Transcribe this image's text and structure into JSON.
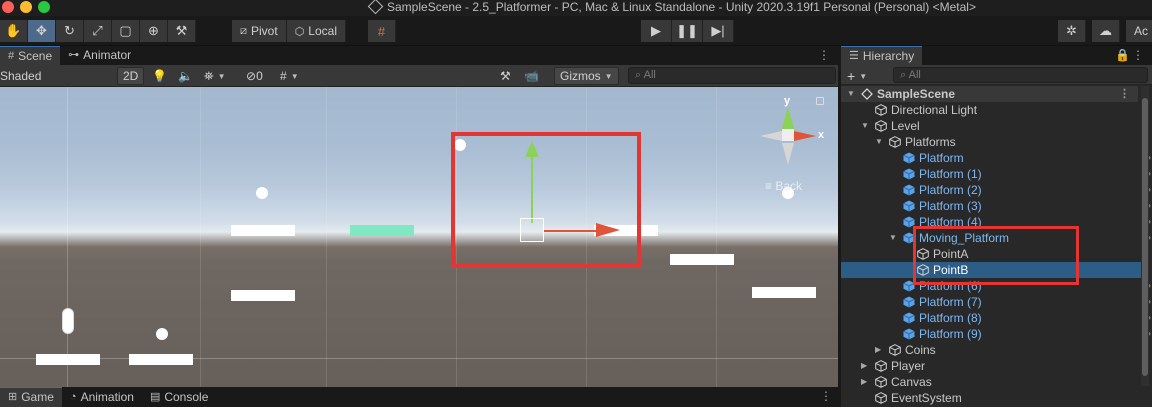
{
  "window": {
    "title": "SampleScene - 2.5_Platformer - PC, Mac & Linux Standalone - Unity 2020.3.19f1 Personal (Personal) <Metal>"
  },
  "toolbar": {
    "tools": [
      "hand-tool",
      "move-tool",
      "rotate-tool",
      "scale-tool",
      "rect-tool",
      "transform-tool",
      "custom-tool"
    ],
    "pivot_label": "Pivot",
    "local_label": "Local",
    "right_partial_label": "Ac"
  },
  "scene_tabs": {
    "scene": "Scene",
    "animator": "Animator"
  },
  "scene_toolbar": {
    "shading_mode": "Shaded",
    "mode_2d": "2D",
    "hidden_count": "0",
    "gizmos_label": "Gizmos",
    "search_placeholder": "All"
  },
  "orientation": {
    "y_label": "y",
    "x_label": "x",
    "back_label": "Back"
  },
  "bottom_tabs": {
    "game": "Game",
    "animation": "Animation",
    "console": "Console"
  },
  "hierarchy": {
    "tab_label": "Hierarchy",
    "add_label": "+",
    "search_placeholder": "All",
    "rows": [
      {
        "name": "SampleScene",
        "depth": 0,
        "kind": "scene",
        "expanded": true
      },
      {
        "name": "Directional Light",
        "depth": 1,
        "kind": "object"
      },
      {
        "name": "Level",
        "depth": 1,
        "kind": "object",
        "expanded": true
      },
      {
        "name": "Platforms",
        "depth": 2,
        "kind": "object",
        "expanded": true
      },
      {
        "name": "Platform",
        "depth": 3,
        "kind": "prefab"
      },
      {
        "name": "Platform (1)",
        "depth": 3,
        "kind": "prefab"
      },
      {
        "name": "Platform (2)",
        "depth": 3,
        "kind": "prefab"
      },
      {
        "name": "Platform (3)",
        "depth": 3,
        "kind": "prefab"
      },
      {
        "name": "Platform (4)",
        "depth": 3,
        "kind": "prefab"
      },
      {
        "name": "Moving_Platform",
        "depth": 3,
        "kind": "prefab",
        "expanded": true
      },
      {
        "name": "PointA",
        "depth": 4,
        "kind": "object"
      },
      {
        "name": "PointB",
        "depth": 4,
        "kind": "object",
        "selected": true
      },
      {
        "name": "Platform (6)",
        "depth": 3,
        "kind": "prefab"
      },
      {
        "name": "Platform (7)",
        "depth": 3,
        "kind": "prefab"
      },
      {
        "name": "Platform (8)",
        "depth": 3,
        "kind": "prefab"
      },
      {
        "name": "Platform (9)",
        "depth": 3,
        "kind": "prefab"
      },
      {
        "name": "Coins",
        "depth": 2,
        "kind": "object",
        "expanded": false
      },
      {
        "name": "Player",
        "depth": 1,
        "kind": "object",
        "expanded": false
      },
      {
        "name": "Canvas",
        "depth": 1,
        "kind": "object",
        "expanded": false
      },
      {
        "name": "EventSystem",
        "depth": 1,
        "kind": "object"
      }
    ]
  },
  "colors": {
    "selection": "#2c5d87",
    "prefab_text": "#7fb8f2",
    "highlight_box": "#e33531",
    "active_tool": "#4d6a8a"
  }
}
